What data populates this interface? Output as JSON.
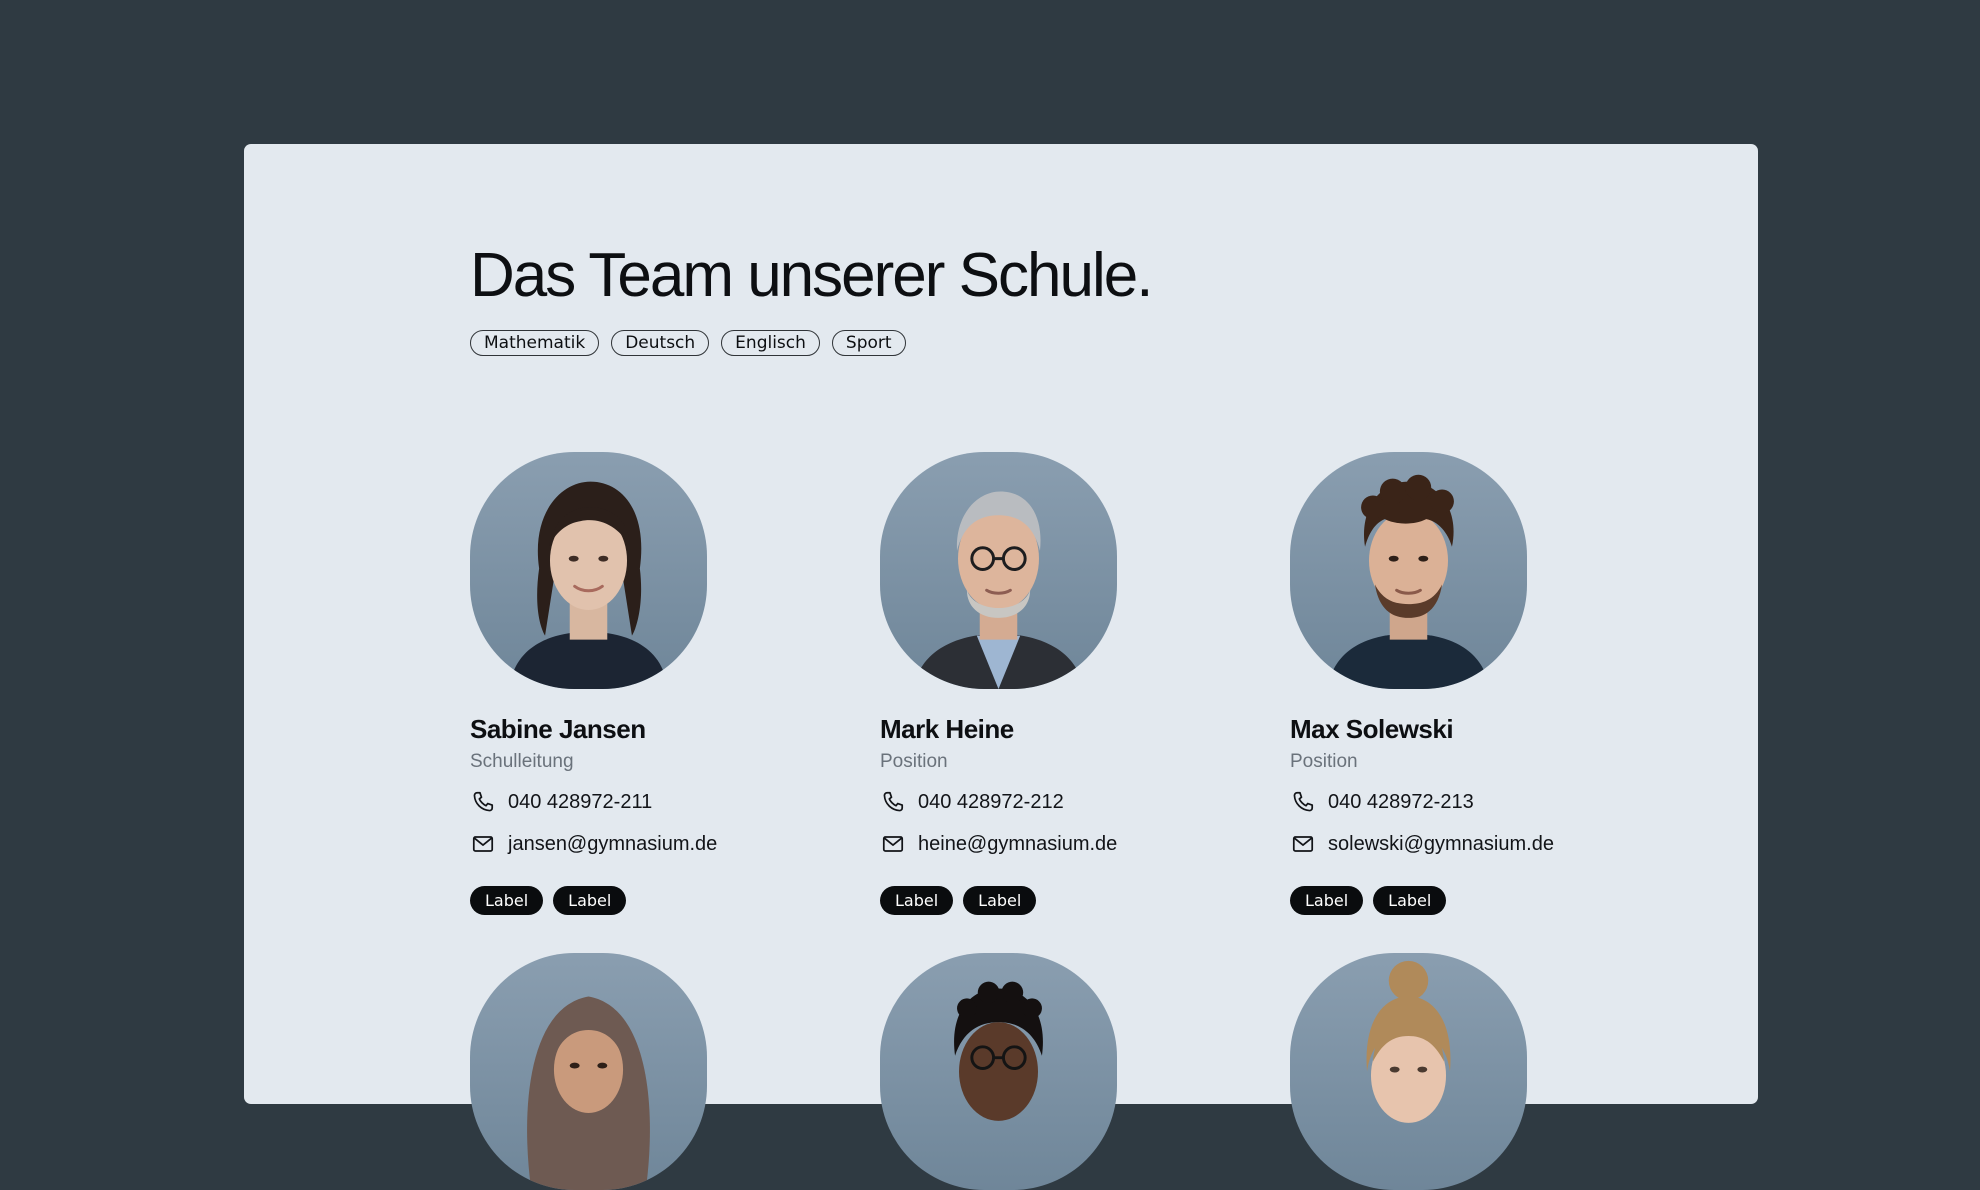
{
  "page": {
    "title": "Das Team unserer Schule."
  },
  "filters": [
    "Mathematik",
    "Deutsch",
    "Englisch",
    "Sport"
  ],
  "team": [
    {
      "name": "Sabine Jansen",
      "role": "Schulleitung",
      "phone": "040 428972-211",
      "email": "jansen@gymnasium.de",
      "tags": [
        "Label",
        "Label"
      ],
      "photo": "portrait-woman-dark-hair"
    },
    {
      "name": "Mark Heine",
      "role": "Position",
      "phone": "040 428972-212",
      "email": "heine@gymnasium.de",
      "tags": [
        "Label",
        "Label"
      ],
      "photo": "portrait-man-grey-hair-glasses"
    },
    {
      "name": "Max Solewski",
      "role": "Position",
      "phone": "040 428972-213",
      "email": "solewski@gymnasium.de",
      "tags": [
        "Label",
        "Label"
      ],
      "photo": "portrait-man-curly-hair"
    },
    {
      "photo": "portrait-woman-hijab"
    },
    {
      "photo": "portrait-man-glasses"
    },
    {
      "photo": "portrait-woman-blonde-bun"
    }
  ],
  "icons": {
    "phone": "phone-icon",
    "email": "mail-icon"
  },
  "colors": {
    "background": "#2f3a42",
    "panel": "#e3e9ef",
    "text": "#0d0f12",
    "muted": "#6a727b",
    "tag_bg": "#0a0c0e"
  }
}
